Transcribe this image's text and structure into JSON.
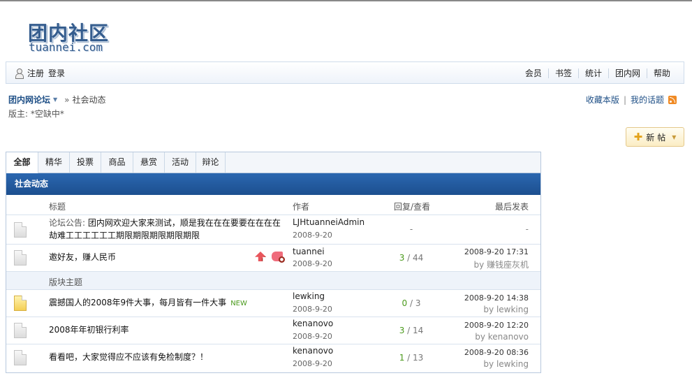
{
  "logo": {
    "cn": "团内社区",
    "en": "tuannei.com"
  },
  "topbar": {
    "register": "注册",
    "login": "登录",
    "nav": [
      "会员",
      "书签",
      "统计",
      "团内网",
      "帮助"
    ]
  },
  "breadcrumb": {
    "forum": "团内网论坛",
    "separator": "»",
    "current": "社会动态"
  },
  "moderator": "版主: *空缺中*",
  "top_actions": {
    "favorite": "收藏本版",
    "pipe": "|",
    "my_topics": "我的话题"
  },
  "new_post": {
    "label": "新帖"
  },
  "tabs": [
    "全部",
    "精华",
    "投票",
    "商品",
    "悬赏",
    "活动",
    "辩论"
  ],
  "board": {
    "title": "社会动态",
    "columns": {
      "subject": "标题",
      "author": "作者",
      "stats": "回复/查看",
      "last_post": "最后发表"
    },
    "announcements": [
      {
        "prefix": "论坛公告:",
        "title": "团内网欢迎大家来测试，顺是我在在在要要在在在在劫难工工工工工工期限期限期限期限期限",
        "author": "LJHtuanneiAdmin",
        "date": "2008-9-20",
        "stats": "-",
        "last": "-"
      },
      {
        "title": "邀好友，赚人民币",
        "author": "tuannei",
        "date": "2008-9-20",
        "replies": "3",
        "views": "44",
        "last_time": "2008-9-20 17:31",
        "last_by": "by 赚钱座灰机"
      }
    ],
    "section_label": "版块主题",
    "threads": [
      {
        "title": "震撼国人的2008年9件大事，每月皆有一件大事",
        "new_badge": "NEW",
        "author": "lewking",
        "date": "2008-9-20",
        "replies": "0",
        "views": "3",
        "last_time": "2008-9-20 14:38",
        "last_by": "by lewking"
      },
      {
        "title": "2008年年初银行利率",
        "author": "kenanovo",
        "date": "2008-9-20",
        "replies": "3",
        "views": "14",
        "last_time": "2008-9-20 12:20",
        "last_by": "by kenanovo"
      },
      {
        "title": "看看吧，大家觉得应不应该有免检制度？！",
        "author": "kenanovo",
        "date": "2008-9-20",
        "replies": "1",
        "views": "13",
        "last_time": "2008-9-20 08:36",
        "last_by": "by lewking"
      }
    ],
    "separator": " / "
  }
}
